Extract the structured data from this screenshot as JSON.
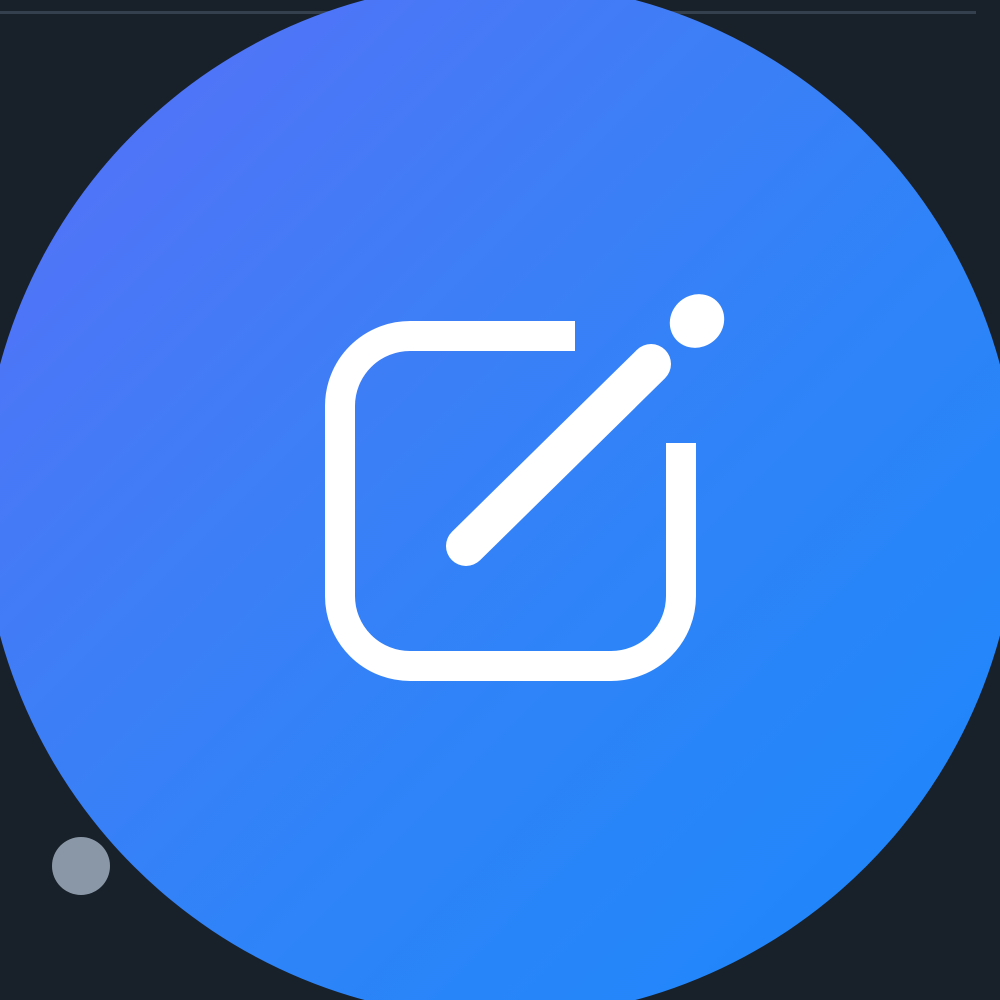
{
  "compose_button": {
    "icon": "edit-square-icon",
    "colors": {
      "gradient_start": "#5a6ff8",
      "gradient_end": "#1a88fb",
      "icon": "#ffffff"
    }
  },
  "status_indicator": {
    "icon": "status-dot",
    "color": "#8a97a6"
  },
  "background_color": "#18202a"
}
